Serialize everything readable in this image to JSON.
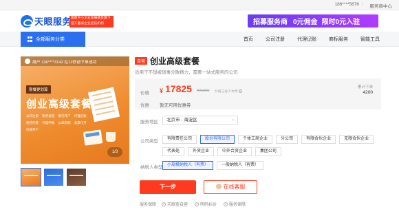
{
  "topbar": {
    "phone": "186****5676",
    "separator": "|",
    "service_center": "服务商中心"
  },
  "header": {
    "logo_text": "天眼服务",
    "slogan_line1": "国家中小企业发展基金旗下",
    "slogan_line2": "官方备案企业征信机构",
    "promo": {
      "part1": "招募服务商",
      "part2": "0元佣金",
      "part3": "限时0元入驻"
    }
  },
  "nav": {
    "all_categories": "全部服务分类",
    "items": [
      "首页",
      "公司注册",
      "代理记账",
      "商标服务",
      "智能工具"
    ]
  },
  "gallery": {
    "ticker": "用户 136****3142 在12秒前下单成功",
    "tag": "套餐更划算",
    "title": "创业高级套餐",
    "features": [
      "公司注册",
      "税务报道",
      "银行开户",
      "代理记账",
      "税控托管",
      "代理申报",
      "公章刻制",
      "发票代开",
      "社保开户"
    ],
    "counter": "1/3"
  },
  "product": {
    "badge": "自营",
    "title": "创业高级套餐",
    "subtitle": "适用于不想被琐事分散精力，需要一站式服务的公司"
  },
  "price": {
    "label": "价格",
    "currency": "¥",
    "value": "17825",
    "original": "¥21390",
    "note": "价格已含工本费",
    "note_icon": "?",
    "sales_label": "累计下单",
    "sales_value": "4200",
    "discount_label": "优惠",
    "discount_value": "暂无可用优惠券"
  },
  "region": {
    "label": "服务地区",
    "value": "北京市 - 海淀区",
    "arrow": "⌄"
  },
  "company_type": {
    "label": "公司类型",
    "options": [
      "有限责任公司",
      "股份有限公司",
      "个体工商企业",
      "分公司",
      "有限合伙企业",
      "无限合伙企业",
      "代表处",
      "外资企业",
      "中外合资企业",
      "集团公司"
    ],
    "selected_index": 1
  },
  "taxpayer": {
    "label": "纳税人类型",
    "options": [
      "小规模纳税人（有票）",
      "一般纳税人（有票）"
    ],
    "selected_index": 0
  },
  "actions": {
    "next": "下一步",
    "online_service": "在线客服"
  },
  "guarantee": {
    "label": "服务保障",
    "items": [
      "天眼查自营",
      "明码标价",
      "服务保障"
    ],
    "check": "✓"
  }
}
